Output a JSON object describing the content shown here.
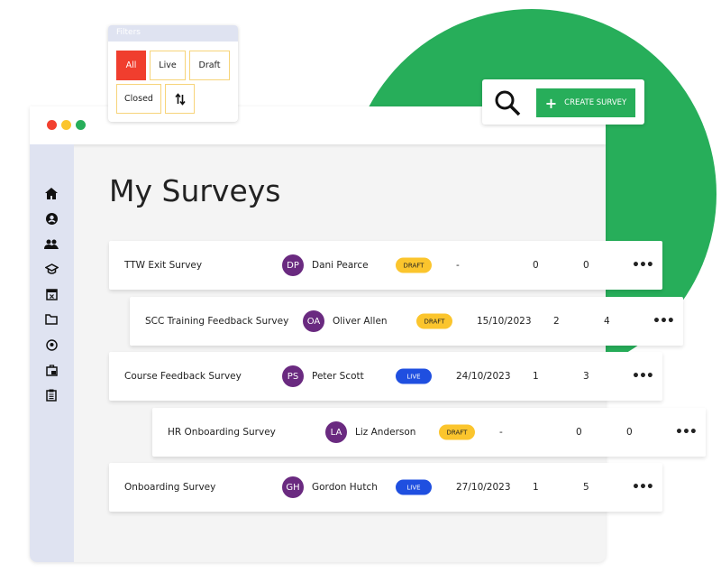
{
  "colors": {
    "accent": "#27ae5a",
    "filter_active": "#f03e2e",
    "draft": "#fbc52d",
    "live": "#1f4fe0",
    "avatar": "#6a2a80"
  },
  "filters": {
    "title": "Filters",
    "buttons": [
      "All",
      "Live",
      "Draft",
      "Closed"
    ],
    "active": "All",
    "sort_icon": "sort-arrows-icon"
  },
  "toolbar": {
    "search_icon": "search-icon",
    "create_label": "CREATE SURVEY"
  },
  "page": {
    "title": "My Surveys"
  },
  "sidebar": {
    "icons": [
      "home-icon",
      "account-icon",
      "group-icon",
      "graduation-cap-icon",
      "calendar-cancel-icon",
      "folder-icon",
      "support-icon",
      "briefcase-icon",
      "clipboard-icon"
    ]
  },
  "surveys": [
    {
      "name": "TTW Exit Survey",
      "initials": "DP",
      "owner": "Dani Pearce",
      "status": "DRAFT",
      "date": "-",
      "n1": "0",
      "n2": "0"
    },
    {
      "name": "SCC Training Feedback Survey",
      "initials": "OA",
      "owner": "Oliver Allen",
      "status": "DRAFT",
      "date": "15/10/2023",
      "n1": "2",
      "n2": "4"
    },
    {
      "name": "Course Feedback Survey",
      "initials": "PS",
      "owner": "Peter Scott",
      "status": "LIVE",
      "date": "24/10/2023",
      "n1": "1",
      "n2": "3"
    },
    {
      "name": "HR Onboarding Survey",
      "initials": "LA",
      "owner": "Liz Anderson",
      "status": "DRAFT",
      "date": "-",
      "n1": "0",
      "n2": "0"
    },
    {
      "name": "Onboarding Survey",
      "initials": "GH",
      "owner": "Gordon Hutch",
      "status": "LIVE",
      "date": "27/10/2023",
      "n1": "1",
      "n2": "5"
    }
  ]
}
